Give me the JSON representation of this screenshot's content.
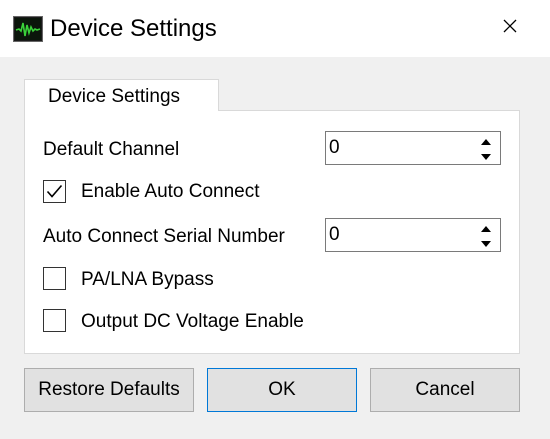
{
  "window": {
    "title": "Device Settings",
    "app_icon": "waveform-monitor-icon",
    "close_icon": "close-icon",
    "close_glyph": "✕"
  },
  "tabs": [
    {
      "label": "Device Settings",
      "selected": true
    }
  ],
  "form": {
    "default_channel": {
      "label": "Default Channel",
      "value": "0"
    },
    "enable_auto_connect": {
      "label": "Enable Auto Connect",
      "checked": true
    },
    "auto_connect_serial": {
      "label": "Auto Connect Serial Number",
      "value": "0"
    },
    "pa_lna_bypass": {
      "label": "PA/LNA Bypass",
      "checked": false
    },
    "output_dc_voltage": {
      "label": "Output DC Voltage Enable",
      "checked": false
    }
  },
  "buttons": {
    "restore_defaults": "Restore Defaults",
    "ok": "OK",
    "cancel": "Cancel"
  },
  "colors": {
    "window_bg": "#f0f0f0",
    "panel_bg": "#ffffff",
    "button_bg": "#e1e1e1",
    "button_border": "#adadad",
    "focus_border": "#0078d7",
    "icon_wave": "#3ad13a"
  }
}
